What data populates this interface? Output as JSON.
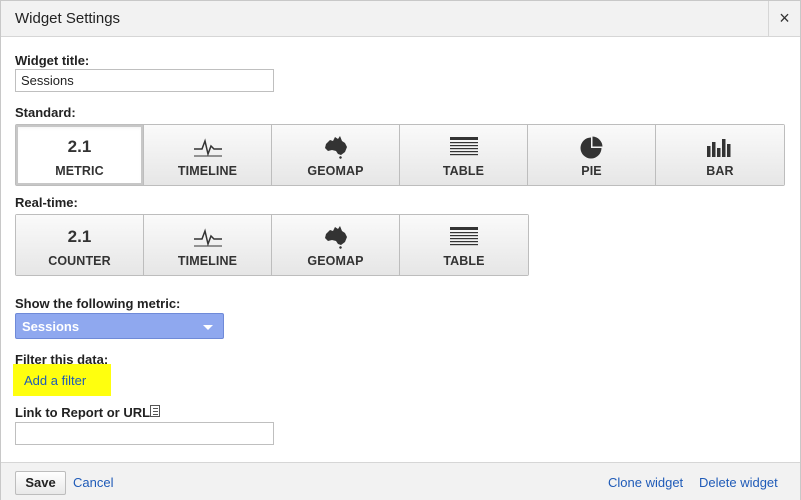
{
  "dialog": {
    "title": "Widget Settings",
    "close_icon": "×"
  },
  "widget_title": {
    "label": "Widget title:",
    "value": "Sessions"
  },
  "standard": {
    "label": "Standard:",
    "tiles": [
      {
        "icon_text": "2.1",
        "icon": "metric-number",
        "label": "METRIC",
        "selected": true
      },
      {
        "icon": "timeline-icon",
        "label": "TIMELINE",
        "selected": false
      },
      {
        "icon": "geomap-icon",
        "label": "GEOMAP",
        "selected": false
      },
      {
        "icon": "table-icon",
        "label": "TABLE",
        "selected": false
      },
      {
        "icon": "pie-icon",
        "label": "PIE",
        "selected": false
      },
      {
        "icon": "bar-icon",
        "label": "BAR",
        "selected": false
      }
    ]
  },
  "realtime": {
    "label": "Real-time:",
    "tiles": [
      {
        "icon_text": "2.1",
        "icon": "counter-number",
        "label": "COUNTER"
      },
      {
        "icon": "timeline-icon",
        "label": "TIMELINE"
      },
      {
        "icon": "geomap-icon",
        "label": "GEOMAP"
      },
      {
        "icon": "table-icon",
        "label": "TABLE"
      }
    ]
  },
  "metric": {
    "label": "Show the following metric:",
    "selected": "Sessions"
  },
  "filter": {
    "label": "Filter this data:",
    "add_link": "Add a filter",
    "highlight_color": "#ffff0e"
  },
  "link_report": {
    "label": "Link to Report or URL:",
    "value": ""
  },
  "footer": {
    "save": "Save",
    "cancel": "Cancel",
    "clone": "Clone widget",
    "delete": "Delete widget"
  },
  "colors": {
    "link": "#1f5bb8",
    "select_bg": "#8fa8ef"
  }
}
